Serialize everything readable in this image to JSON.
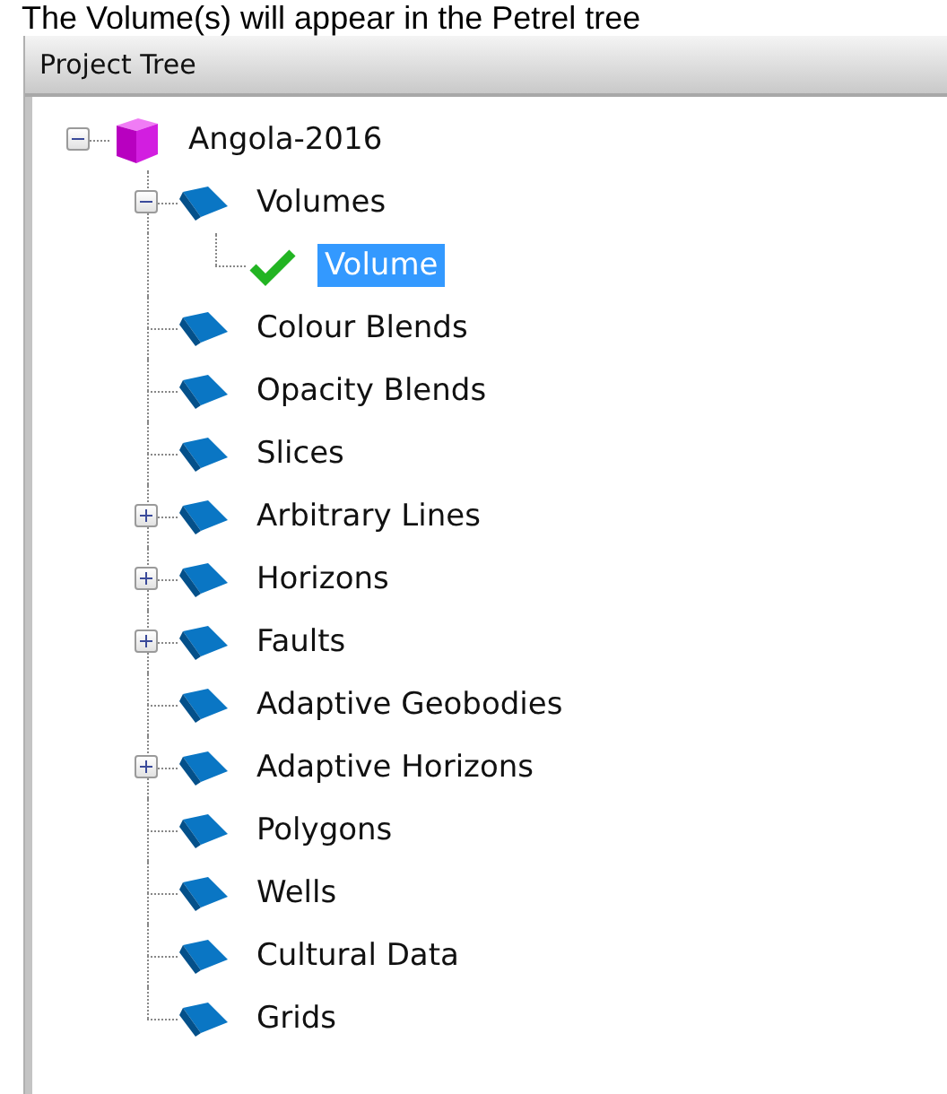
{
  "caption": "The Volume(s) will appear in the Petrel tree",
  "panel": {
    "title": "Project Tree"
  },
  "tree": [
    {
      "label": "Angola-2016",
      "kind": "cube",
      "expanded": true,
      "selected": false,
      "children": [
        {
          "label": "Volumes",
          "kind": "folder",
          "expanded": true,
          "selected": false,
          "children": [
            {
              "label": "Volume",
              "kind": "check",
              "selected": true
            }
          ]
        },
        {
          "label": "Colour Blends",
          "kind": "folder",
          "selected": false
        },
        {
          "label": "Opacity Blends",
          "kind": "folder",
          "selected": false
        },
        {
          "label": "Slices",
          "kind": "folder",
          "selected": false
        },
        {
          "label": "Arbitrary Lines",
          "kind": "folder",
          "expanded": false,
          "selected": false
        },
        {
          "label": "Horizons",
          "kind": "folder",
          "expanded": false,
          "selected": false
        },
        {
          "label": "Faults",
          "kind": "folder",
          "expanded": false,
          "selected": false
        },
        {
          "label": "Adaptive Geobodies",
          "kind": "folder",
          "selected": false
        },
        {
          "label": "Adaptive Horizons",
          "kind": "folder",
          "expanded": false,
          "selected": false
        },
        {
          "label": "Polygons",
          "kind": "folder",
          "selected": false
        },
        {
          "label": "Wells",
          "kind": "folder",
          "selected": false
        },
        {
          "label": "Cultural Data",
          "kind": "folder",
          "selected": false
        },
        {
          "label": "Grids",
          "kind": "folder",
          "selected": false
        }
      ]
    }
  ]
}
